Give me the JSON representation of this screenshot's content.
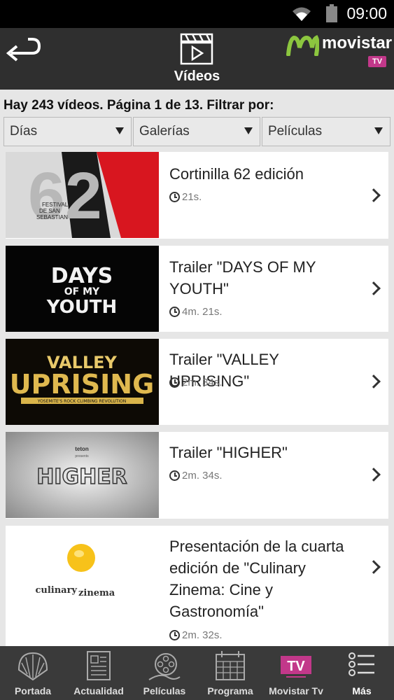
{
  "status_bar": {
    "time": "09:00"
  },
  "header": {
    "title": "Vídeos",
    "brand_name": "movistar",
    "brand_badge": "TV",
    "brand_color": "#c2388a",
    "logo_green": "#8cc63f"
  },
  "info_text": "Hay 243 vídeos. Página 1 de 13. Filtrar por:",
  "filters": [
    {
      "label": "Días"
    },
    {
      "label": "Galerías"
    },
    {
      "label": "Películas"
    }
  ],
  "videos": [
    {
      "title_lines": [
        "Cortinilla 62 edición"
      ],
      "duration": "21s.",
      "thumb_text": [
        "62",
        "FESTIVAL",
        "DE SAN",
        "SEBASTIAN"
      ]
    },
    {
      "title_lines": [
        "Trailer \"DAYS OF MY",
        "YOUTH\""
      ],
      "duration": "4m. 21s.",
      "thumb_text": [
        "DAYS",
        "OF MY",
        "YOUTH"
      ]
    },
    {
      "title_lines": [
        "Trailer \"VALLEY UPRISING\""
      ],
      "duration": "2m. 34s.",
      "thumb_text": [
        "VALLEY",
        "UPRISING",
        "YOSEMITE'S ROCK CLIMBING REVOLUTION"
      ]
    },
    {
      "title_lines": [
        "Trailer \"HIGHER\""
      ],
      "duration": "2m. 34s.",
      "thumb_text": [
        "teton",
        "presents",
        "HIGHER"
      ]
    },
    {
      "title_lines": [
        "Presentación de la cuarta",
        "edición de \"Culinary",
        "Zinema: Cine y",
        "Gastronomía\""
      ],
      "duration": "2m. 32s.",
      "thumb_text": [
        "culinary",
        "zinema"
      ]
    }
  ],
  "bottom_nav": [
    {
      "label": "Portada",
      "icon": "shell-icon"
    },
    {
      "label": "Actualidad",
      "icon": "newspaper-icon"
    },
    {
      "label": "Películas",
      "icon": "film-reel-icon"
    },
    {
      "label": "Programa",
      "icon": "calendar-icon"
    },
    {
      "label": "Movistar Tv",
      "icon": "tv-icon",
      "icon_text": "TV"
    },
    {
      "label": "Más",
      "icon": "menu-list-icon",
      "active": true
    }
  ]
}
